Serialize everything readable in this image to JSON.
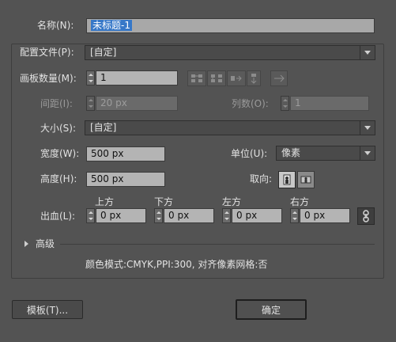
{
  "name": {
    "label": "名称(N):",
    "value": "未标题-1"
  },
  "profile": {
    "label": "配置文件(P):",
    "value": "[自定]"
  },
  "artboards": {
    "label": "画板数量(M):",
    "value": "1"
  },
  "spacing": {
    "label": "间距(I):",
    "value": "20 px"
  },
  "columns": {
    "label": "列数(O):",
    "value": "1"
  },
  "size": {
    "label": "大小(S):",
    "value": "[自定]"
  },
  "width": {
    "label": "宽度(W):",
    "value": "500 px"
  },
  "units": {
    "label": "单位(U):",
    "value": "像素"
  },
  "height": {
    "label": "高度(H):",
    "value": "500 px"
  },
  "orientation": {
    "label": "取向:"
  },
  "bleed": {
    "label": "出血(L):",
    "top": {
      "label": "上方",
      "value": "0 px"
    },
    "bottom": {
      "label": "下方",
      "value": "0 px"
    },
    "left": {
      "label": "左方",
      "value": "0 px"
    },
    "right": {
      "label": "右方",
      "value": "0 px"
    }
  },
  "advanced": {
    "label": "高级"
  },
  "summary": "颜色模式:CMYK,PPI:300, 对齐像素网格:否",
  "buttons": {
    "templates": "模板(T)...",
    "ok": "确定"
  }
}
